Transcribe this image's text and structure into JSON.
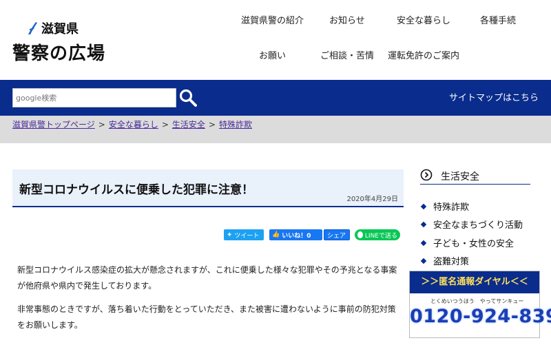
{
  "header": {
    "pref_name": "滋賀県",
    "site_title": "警察の広場",
    "nav": [
      {
        "label": "滋賀県警の紹介"
      },
      {
        "label": "お知らせ"
      },
      {
        "label": "安全な暮らし"
      },
      {
        "label": "各種手続"
      },
      {
        "label": "お願い"
      },
      {
        "label": "ご相談・苦情"
      },
      {
        "label": "運転免許のご案内"
      }
    ]
  },
  "search": {
    "placeholder": "google検索"
  },
  "sitemap_label": "サイトマップはこちら",
  "breadcrumb": [
    {
      "label": "滋賀県警トップページ"
    },
    {
      "label": "安全な暮らし"
    },
    {
      "label": "生活安全"
    },
    {
      "label": "特殊詐欺"
    }
  ],
  "breadcrumb_sep": ">",
  "article": {
    "title": "新型コロナウイルスに便乗した犯罪に注意！",
    "date": "2020年4月29日",
    "share": {
      "tweet": "ツイート",
      "like": "いいね！0",
      "share": "シェア",
      "line": "LINEで送る"
    },
    "paragraphs": [
      "新型コロナウイルス感染症の拡大が懸念されますが、これに便乗した様々な犯罪やその予兆となる事案が他府県や県内で発生しております。",
      "非常事態のときですが、落ち着いた行動をとっていただき、また被害に遭わないように事前の防犯対策をお願いします。"
    ]
  },
  "sidebar": {
    "heading": "生活安全",
    "items": [
      {
        "label": "特殊詐欺"
      },
      {
        "label": "安全なまちづくり活動"
      },
      {
        "label": "子ども・女性の安全"
      },
      {
        "label": "盗難対策"
      }
    ],
    "banner": {
      "title": "＞＞匿名通報ダイヤル＜＜",
      "kana": "とくめいつうほう　やってサンキュー",
      "number": "0120-924-839"
    }
  },
  "colors": {
    "primary": "#0a2c8c",
    "title_bg": "#e9f1fb",
    "crumb_bg": "#dcdcdc",
    "banner_text": "#ffe05a"
  }
}
